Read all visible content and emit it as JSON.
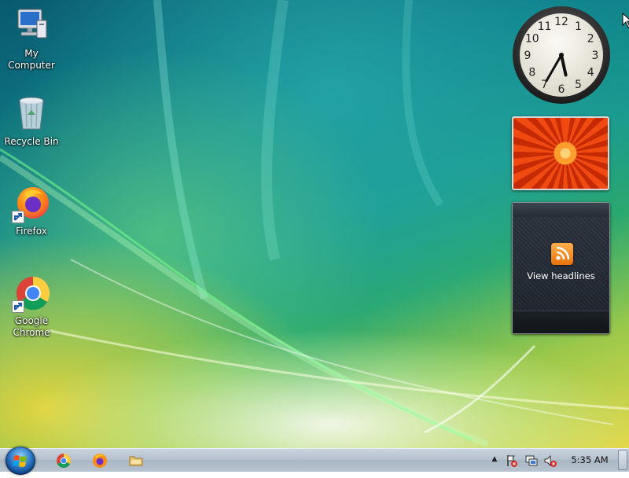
{
  "desktop": {
    "icons": [
      {
        "label": "My Computer",
        "icon": "computer-icon"
      },
      {
        "label": "Recycle Bin",
        "icon": "recycle-bin-icon"
      },
      {
        "label": "Firefox",
        "icon": "firefox-icon"
      },
      {
        "label": "Google Chrome",
        "icon": "chrome-icon"
      }
    ]
  },
  "gadgets": {
    "clock": {
      "numerals": [
        "12",
        "1",
        "2",
        "3",
        "4",
        "5",
        "6",
        "7",
        "8",
        "9",
        "10",
        "11"
      ],
      "time": "5:35"
    },
    "slideshow": {
      "subject": "orange flower"
    },
    "feed": {
      "label": "View headlines",
      "icon": "rss-icon"
    }
  },
  "taskbar": {
    "start": {
      "icon": "windows-orb-icon"
    },
    "pinned": [
      {
        "icon": "chrome-icon"
      },
      {
        "icon": "firefox-icon"
      },
      {
        "icon": "folder-icon"
      }
    ],
    "tray": {
      "show_hidden": "▲",
      "icons": [
        "action-center-flag-icon",
        "network-icon",
        "volume-muted-icon"
      ],
      "clock": "5:35 AM"
    }
  },
  "colors": {
    "accent_teal": "#0d7f8a",
    "taskbar": "#b6c2ce",
    "rss_orange": "#e8730e"
  }
}
